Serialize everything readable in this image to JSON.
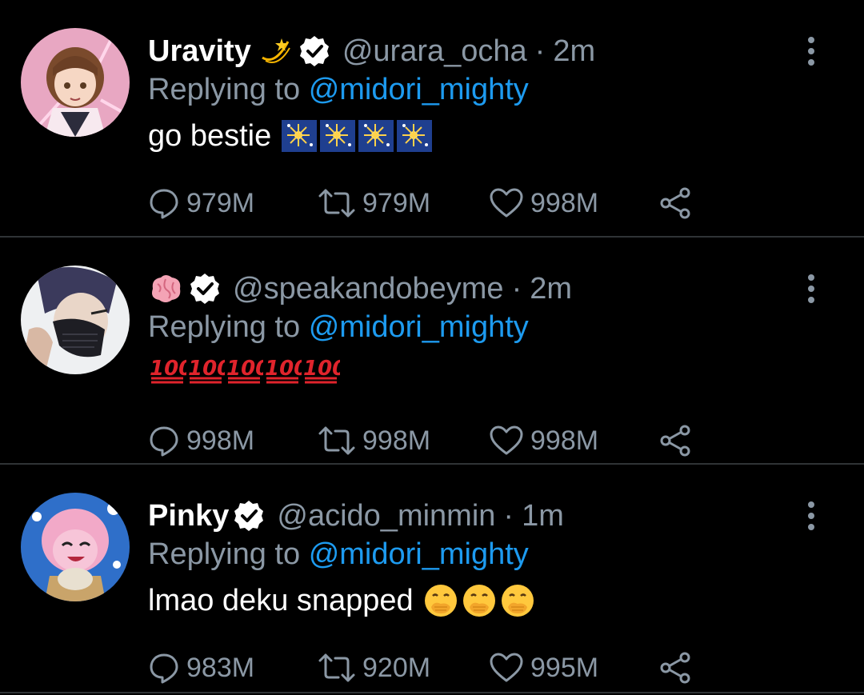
{
  "colors": {
    "background": "#000000",
    "text": "#ffffff",
    "muted": "#8b98a5",
    "mention": "#1d9bf0",
    "divider": "#2f3336"
  },
  "tweets": [
    {
      "display_name": "Uravity",
      "name_emoji": "dizzy-emoji",
      "verified": true,
      "handle": "@urara_ocha",
      "separator": "·",
      "time": "2m",
      "replying_prefix": "Replying to",
      "replying_to": "@midori_mighty",
      "text": "go bestie",
      "body_emoji": "fireworks-emoji",
      "body_emoji_count": 4,
      "replies": "979M",
      "retweets": "979M",
      "likes": "998M"
    },
    {
      "display_name": "",
      "name_emoji": "brain-emoji",
      "verified": true,
      "handle": "@speakandobeyme",
      "separator": "·",
      "time": "2m",
      "replying_prefix": "Replying to",
      "replying_to": "@midori_mighty",
      "text": "",
      "body_emoji": "hundred-points-emoji",
      "body_emoji_count": 5,
      "replies": "998M",
      "retweets": "998M",
      "likes": "998M"
    },
    {
      "display_name": "Pinky",
      "name_emoji": "",
      "verified": true,
      "handle": "@acido_minmin",
      "separator": "·",
      "time": "1m",
      "replying_prefix": "Replying to",
      "replying_to": "@midori_mighty",
      "text": "lmao deku snapped",
      "body_emoji": "face-with-hand-over-mouth-emoji",
      "body_emoji_count": 3,
      "replies": "983M",
      "retweets": "920M",
      "likes": "995M"
    }
  ]
}
